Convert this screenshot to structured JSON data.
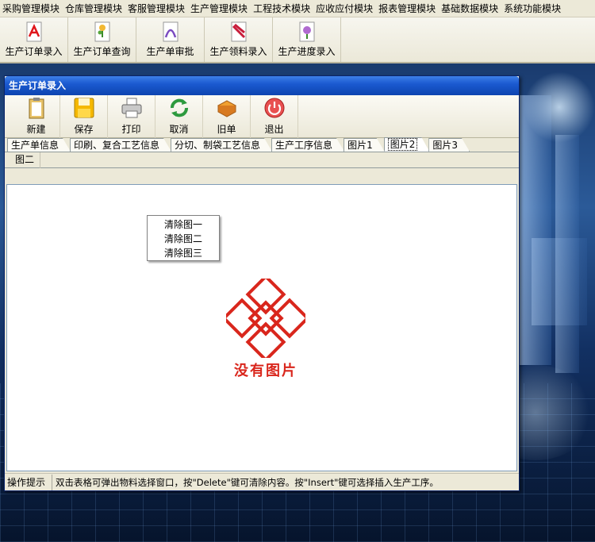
{
  "menubar": {
    "items": [
      "采购管理模块",
      "仓库管理模块",
      "客服管理模块",
      "生产管理模块",
      "工程技术模块",
      "应收应付模块",
      "报表管理模块",
      "基础数据模块",
      "系统功能模块"
    ]
  },
  "quickbar": {
    "items": [
      {
        "label": "生产订单录入",
        "icon": "pdf-document-icon"
      },
      {
        "label": "生产订单查询",
        "icon": "flower-document-icon"
      },
      {
        "label": "生产单审批",
        "icon": "purple-document-icon"
      },
      {
        "label": "生产领料录入",
        "icon": "red-document-icon"
      },
      {
        "label": "生产进度录入",
        "icon": "purple-flower-document-icon"
      }
    ]
  },
  "window": {
    "title": "生产订单录入",
    "toolbar": [
      {
        "label": "新建",
        "icon": "clipboard-icon"
      },
      {
        "label": "保存",
        "icon": "floppy-disk-icon"
      },
      {
        "label": "打印",
        "icon": "printer-icon"
      },
      {
        "label": "取消",
        "icon": "refresh-arrows-icon"
      },
      {
        "label": "旧单",
        "icon": "books-icon"
      },
      {
        "label": "退出",
        "icon": "power-button-icon"
      }
    ],
    "tabs": [
      "生产单信息",
      "印刷、复合工艺信息",
      "分切、制袋工艺信息",
      "生产工序信息",
      "图片1",
      "图片2",
      "图片3"
    ],
    "active_tab": "图片2",
    "subtab": "图二",
    "context_menu": [
      "清除图一",
      "清除图二",
      "清除图三"
    ],
    "placeholder_text": "没有图片",
    "status_label": "操作提示",
    "status_message": "双击表格可弹出物料选择窗口，按\"Delete\"键可清除内容。按\"Insert\"键可选择插入生产工序。"
  },
  "colors": {
    "title_bar": "#1b5ad0",
    "placeholder_red": "#d9261c"
  }
}
